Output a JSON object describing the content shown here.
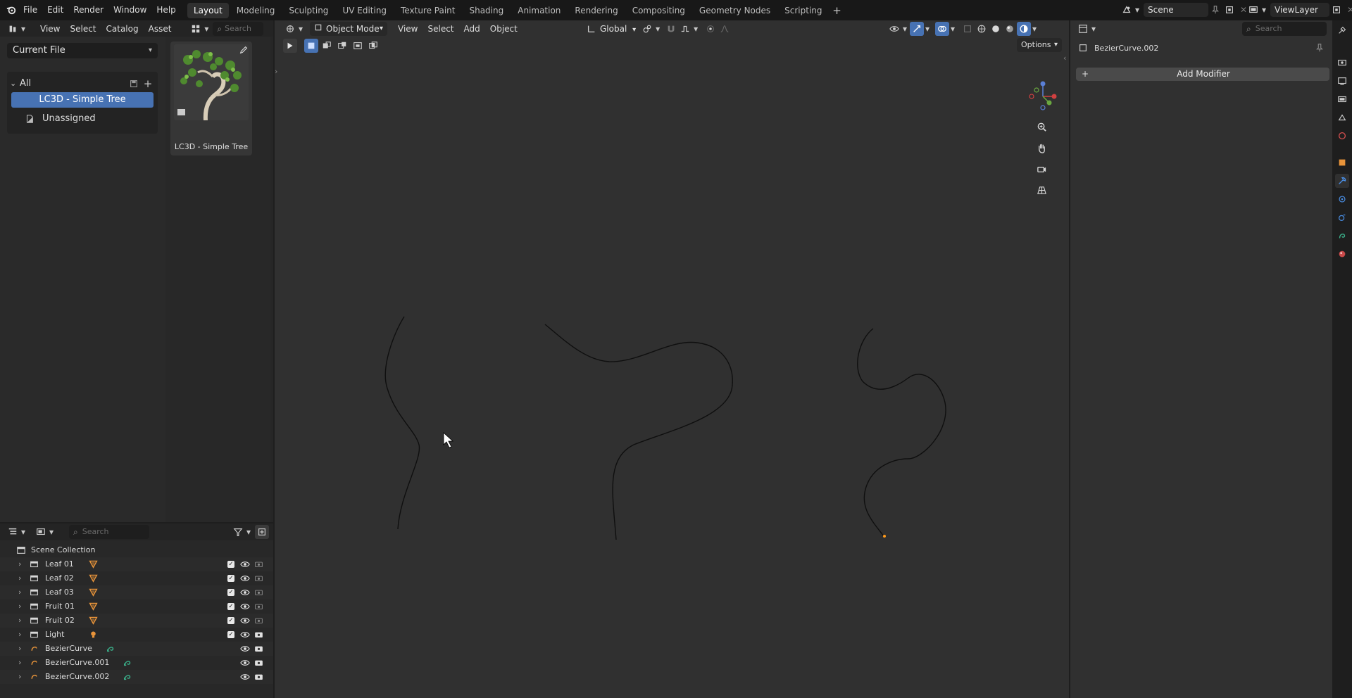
{
  "topbar": {
    "menus": [
      "File",
      "Edit",
      "Render",
      "Window",
      "Help"
    ],
    "workspaces": [
      "Layout",
      "Modeling",
      "Sculpting",
      "UV Editing",
      "Texture Paint",
      "Shading",
      "Animation",
      "Rendering",
      "Compositing",
      "Geometry Nodes",
      "Scripting"
    ],
    "active_workspace": "Layout",
    "scene": "Scene",
    "view_layer": "ViewLayer"
  },
  "asset_browser": {
    "menus": [
      "View",
      "Select",
      "Catalog",
      "Asset"
    ],
    "search_placeholder": "Search",
    "library": "Current File",
    "catalog_root": "All",
    "catalogs": [
      "LC3D - Simple Tree",
      "Unassigned"
    ],
    "selected_catalog": "LC3D - Simple Tree",
    "asset_name": "LC3D - Simple Tree"
  },
  "viewport": {
    "mode": "Object Mode",
    "menus": [
      "View",
      "Select",
      "Add",
      "Object"
    ],
    "orientation": "Global",
    "options_label": "Options"
  },
  "outliner": {
    "search_placeholder": "Search",
    "root": "Scene Collection",
    "items": [
      {
        "name": "Leaf 01",
        "type": "collection",
        "icon": "mesh-icon"
      },
      {
        "name": "Leaf 02",
        "type": "collection",
        "icon": "mesh-icon"
      },
      {
        "name": "Leaf 03",
        "type": "collection",
        "icon": "mesh-icon"
      },
      {
        "name": "Fruit 01",
        "type": "collection",
        "icon": "mesh-icon"
      },
      {
        "name": "Fruit 02",
        "type": "collection",
        "icon": "mesh-icon"
      },
      {
        "name": "Light",
        "type": "collection",
        "icon": "light-icon"
      },
      {
        "name": "BezierCurve",
        "type": "curve",
        "icon": "curve-data-icon"
      },
      {
        "name": "BezierCurve.001",
        "type": "curve",
        "icon": "curve-data-icon"
      },
      {
        "name": "BezierCurve.002",
        "type": "curve",
        "icon": "curve-data-icon"
      }
    ]
  },
  "properties": {
    "object_name": "BezierCurve.002",
    "add_modifier_label": "Add Modifier"
  },
  "colors": {
    "accent": "#4772b3",
    "mesh_orange": "#e8943a",
    "curve_green": "#3bb08a",
    "curve_orange": "#e8943a"
  }
}
